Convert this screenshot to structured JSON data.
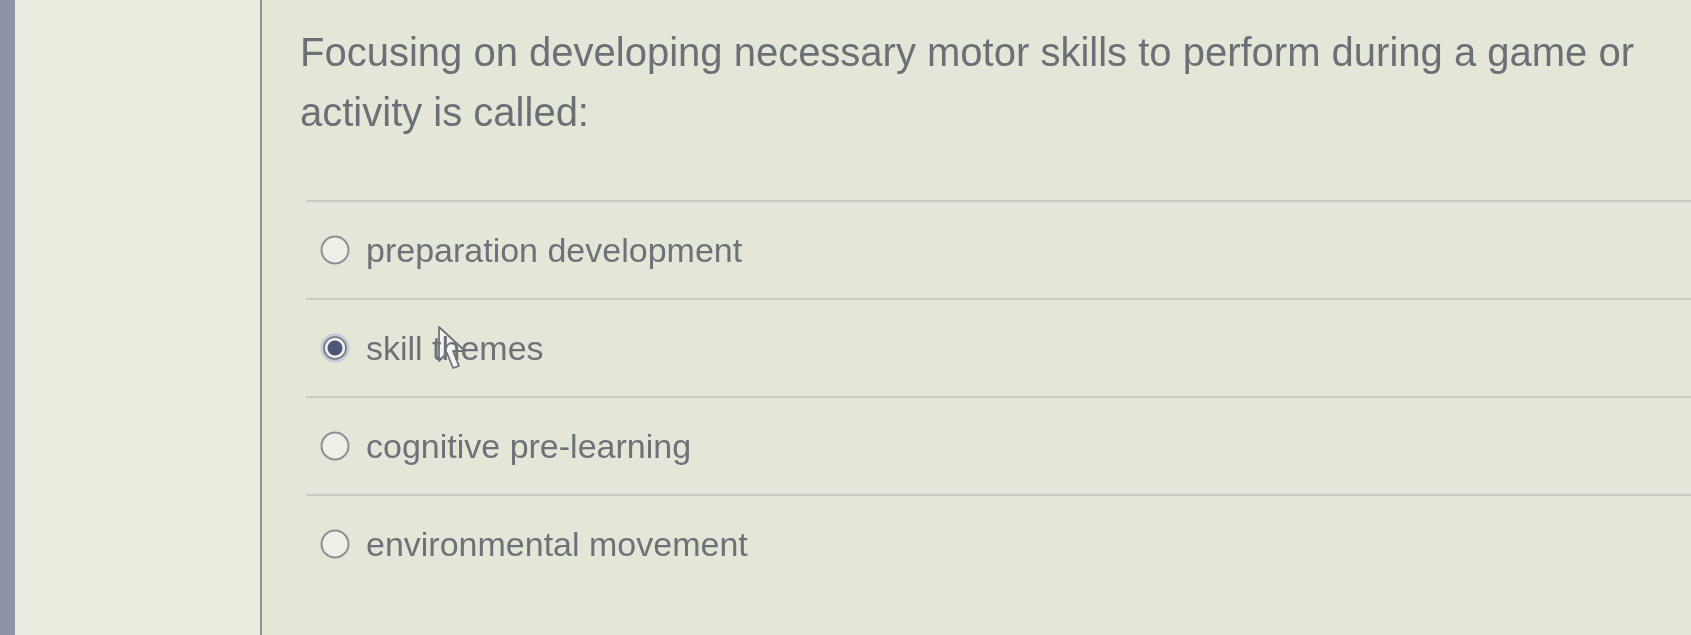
{
  "question": {
    "text": "Focusing on developing necessary motor skills to perform during a game or activity is called:"
  },
  "options": [
    {
      "label": "preparation development",
      "selected": false,
      "hovered": false
    },
    {
      "label": "skill themes",
      "selected": true,
      "hovered": true
    },
    {
      "label": "cognitive pre-learning",
      "selected": false,
      "hovered": false
    },
    {
      "label": "environmental movement",
      "selected": false,
      "hovered": false
    }
  ]
}
